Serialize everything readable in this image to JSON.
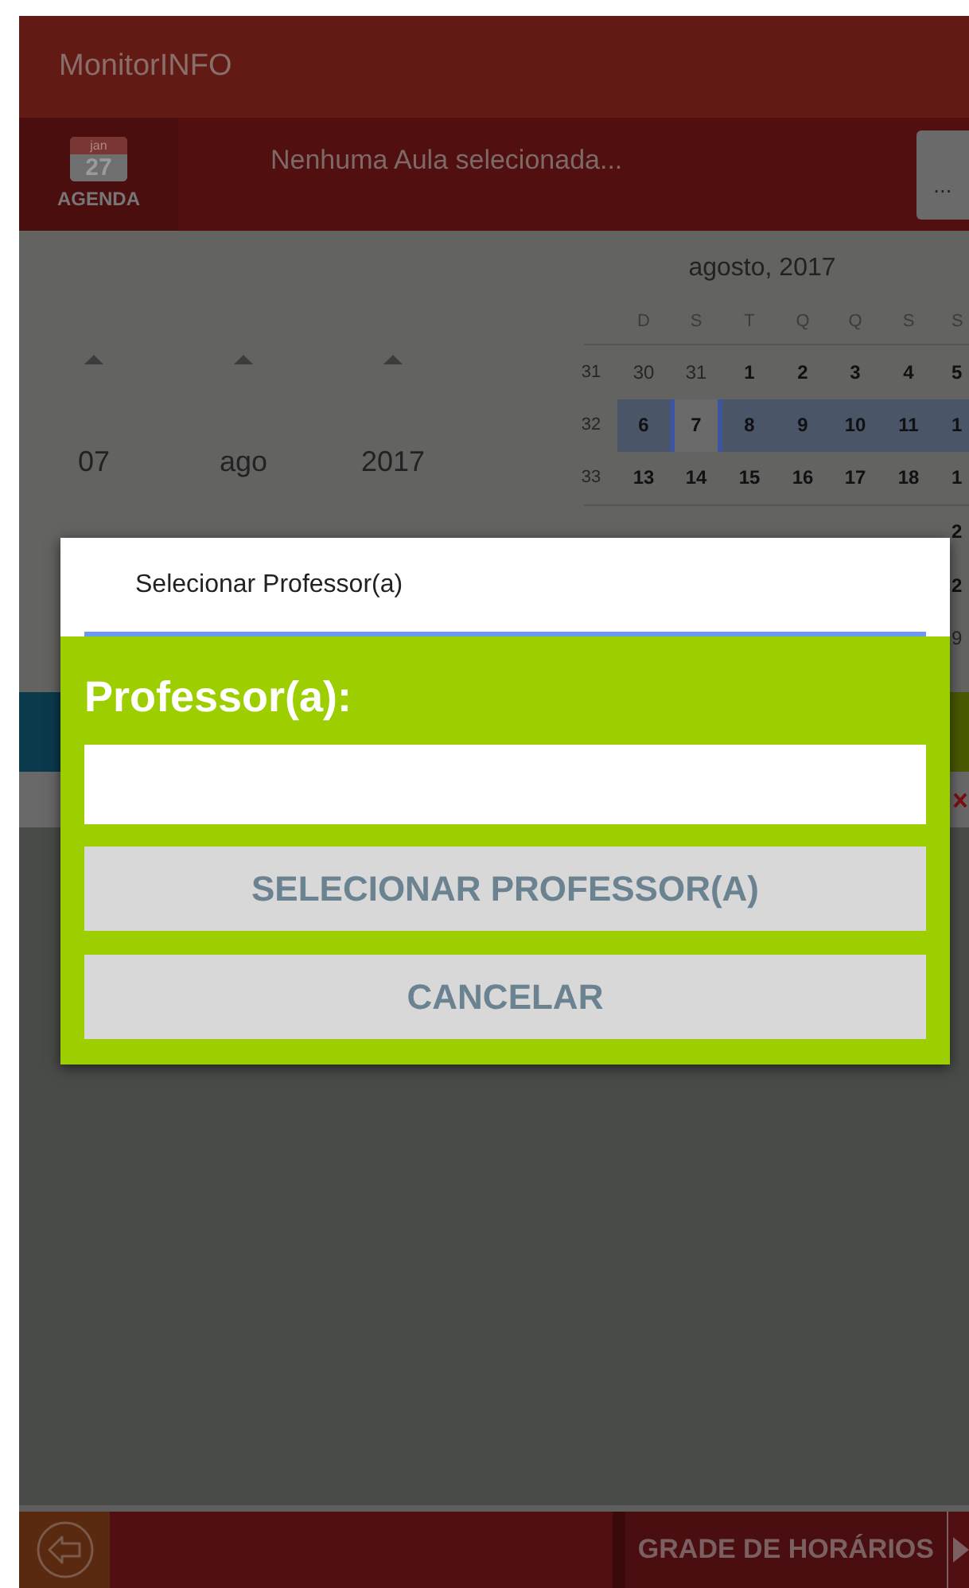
{
  "app_bar": {
    "title": "MonitorINFO"
  },
  "lesson_bar": {
    "agenda_icon": {
      "month": "jan",
      "day": "27",
      "label": "AGENDA"
    },
    "text": "Nenhuma Aula selecionada...",
    "more_button": "..."
  },
  "date_picker": {
    "columns": [
      {
        "value": "07"
      },
      {
        "value": "ago"
      },
      {
        "value": "2017"
      }
    ]
  },
  "calendar": {
    "title": "agosto, 2017",
    "weekdays": [
      "D",
      "S",
      "T",
      "Q",
      "Q",
      "S",
      "S"
    ],
    "weeks": [
      {
        "number": "31",
        "selected": false,
        "days": [
          {
            "text": "30",
            "muted": true,
            "selected": false
          },
          {
            "text": "31",
            "muted": true,
            "selected": false
          },
          {
            "text": "1",
            "muted": false,
            "selected": false
          },
          {
            "text": "2",
            "muted": false,
            "selected": false
          },
          {
            "text": "3",
            "muted": false,
            "selected": false
          },
          {
            "text": "4",
            "muted": false,
            "selected": false
          },
          {
            "text": "5",
            "muted": false,
            "selected": false
          }
        ]
      },
      {
        "number": "32",
        "selected": true,
        "days": [
          {
            "text": "6",
            "muted": false,
            "selected": false
          },
          {
            "text": "7",
            "muted": false,
            "selected": true
          },
          {
            "text": "8",
            "muted": false,
            "selected": false
          },
          {
            "text": "9",
            "muted": false,
            "selected": false
          },
          {
            "text": "10",
            "muted": false,
            "selected": false
          },
          {
            "text": "11",
            "muted": false,
            "selected": false
          },
          {
            "text": "1",
            "muted": false,
            "selected": false
          }
        ]
      },
      {
        "number": "33",
        "selected": false,
        "days": [
          {
            "text": "13",
            "muted": false,
            "selected": false
          },
          {
            "text": "14",
            "muted": false,
            "selected": false
          },
          {
            "text": "15",
            "muted": false,
            "selected": false
          },
          {
            "text": "16",
            "muted": false,
            "selected": false
          },
          {
            "text": "17",
            "muted": false,
            "selected": false
          },
          {
            "text": "18",
            "muted": false,
            "selected": false
          },
          {
            "text": "1",
            "muted": false,
            "selected": false
          }
        ]
      },
      {
        "selected": false,
        "days": [
          {
            "text": "2",
            "muted": false,
            "selected": false
          }
        ]
      },
      {
        "selected": false,
        "days": [
          {
            "text": "2",
            "muted": false,
            "selected": false
          }
        ]
      },
      {
        "selected": false,
        "days": [
          {
            "text": "9",
            "muted": true,
            "selected": false
          }
        ]
      }
    ]
  },
  "dialog": {
    "title": "Selecionar Professor(a)",
    "label": "Professor(a):",
    "buttons": [
      "SELECIONAR PROFESSOR(A)",
      "CANCELAR"
    ]
  },
  "bottom_bar": {
    "button": "GRADE DE HORÁRIOS"
  }
}
